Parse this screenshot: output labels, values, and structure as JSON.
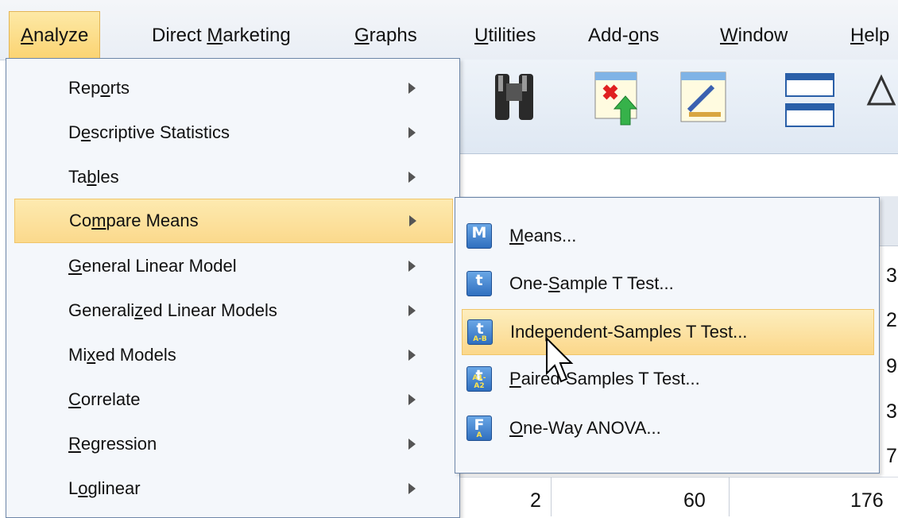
{
  "menubar": {
    "items": [
      {
        "label": "Analyze",
        "active": true
      },
      {
        "label": "Direct Marketing"
      },
      {
        "label": "Graphs"
      },
      {
        "label": "Utilities"
      },
      {
        "label": "Add-ons"
      },
      {
        "label": "Window"
      },
      {
        "label": "Help"
      }
    ]
  },
  "toolbar": {
    "icons": [
      "binoculars-icon",
      "insert-cases-icon",
      "edit-data-icon",
      "split-table-icon",
      "weight-scale-icon"
    ]
  },
  "analyze_menu": {
    "items": [
      {
        "label": "Reports"
      },
      {
        "label": "Descriptive Statistics"
      },
      {
        "label": "Tables"
      },
      {
        "label": "Compare Means",
        "highlighted": true
      },
      {
        "label": "General Linear Model"
      },
      {
        "label": "Generalized Linear Models"
      },
      {
        "label": "Mixed Models"
      },
      {
        "label": "Correlate"
      },
      {
        "label": "Regression"
      },
      {
        "label": "Loglinear"
      }
    ]
  },
  "compare_means_submenu": {
    "items": [
      {
        "label": "Means...",
        "icon": "means-icon",
        "icon_glyph": "M",
        "icon_sub": ""
      },
      {
        "label": "One-Sample T Test...",
        "icon": "one-sample-t-icon",
        "icon_glyph": "t",
        "icon_sub": ""
      },
      {
        "label": "Independent-Samples T Test...",
        "icon": "independent-t-icon",
        "icon_glyph": "t",
        "icon_sub": "A-B",
        "highlighted": true
      },
      {
        "label": "Paired-Samples T Test...",
        "icon": "paired-t-icon",
        "icon_glyph": "t",
        "icon_sub": "A1-A2"
      },
      {
        "label": "One-Way ANOVA...",
        "icon": "anova-icon",
        "icon_glyph": "F",
        "icon_sub": "A"
      }
    ]
  },
  "data_grid": {
    "visible_fragments": [
      "3",
      "2",
      "9",
      "3",
      "7"
    ],
    "last_row": [
      "2",
      "60",
      "176"
    ]
  }
}
